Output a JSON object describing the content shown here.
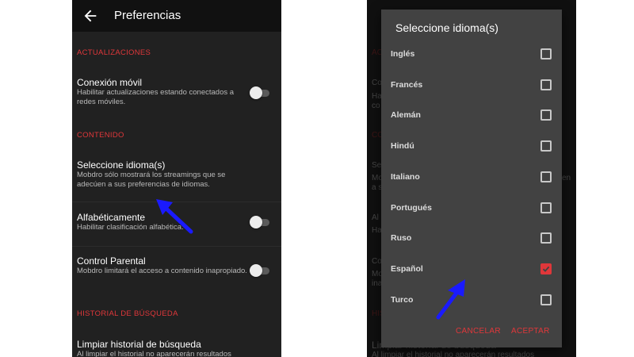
{
  "left_screen": {
    "toolbar_title": "Preferencias",
    "sections": {
      "updates": "ACTUALIZACIONES",
      "content": "CONTENIDO",
      "search_history": "HISTORIAL DE BÚSQUEDA"
    },
    "prefs": {
      "mobile": {
        "title": "Conexión móvil",
        "summary": "Habilitar actualizaciones estando conectados a redes móviles.",
        "enabled": false
      },
      "languages": {
        "title": "Seleccione idioma(s)",
        "summary": "Mobdro sólo mostrará los streamings que se adecúen a sus preferencias de idiomas."
      },
      "alpha": {
        "title": "Alfabéticamente",
        "summary": "Habilitar clasificación alfabética.",
        "enabled": false
      },
      "parental": {
        "title": "Control Parental",
        "summary": "Mobdro limitará el acceso a contenido inapropiado.",
        "enabled": false
      },
      "clear_history": {
        "title": "Limpiar historial de búsqueda",
        "summary": "Al limpiar el historial no aparecerán resultados"
      }
    }
  },
  "right_screen": {
    "bg_fragments": {
      "a": "ACTU",
      "b": "Co",
      "c": "Ha",
      "d": "co",
      "e": "CO",
      "f": "Se",
      "g": "Mo",
      "h": "a s",
      "i": "en",
      "j": "Al",
      "k": "Ha",
      "l": "Co",
      "m": "Mo",
      "n": "ina",
      "o": "HIS",
      "p": "Limpiar historial de búsqueda",
      "q": "Al limpiar el historial no aparecerán resultados"
    },
    "dialog": {
      "title": "Seleccione idioma(s)",
      "options": [
        {
          "label": "Inglés",
          "checked": false
        },
        {
          "label": "Francés",
          "checked": false
        },
        {
          "label": "Alemán",
          "checked": false
        },
        {
          "label": "Hindú",
          "checked": false
        },
        {
          "label": "Italiano",
          "checked": false
        },
        {
          "label": "Portugués",
          "checked": false
        },
        {
          "label": "Ruso",
          "checked": false
        },
        {
          "label": "Español",
          "checked": true
        },
        {
          "label": "Turco",
          "checked": false
        }
      ],
      "cancel_label": "CANCELAR",
      "accept_label": "ACEPTAR"
    }
  },
  "colors": {
    "accent": "#e0373a",
    "background": "#212121",
    "toolbar": "#111111",
    "dialog": "#424242",
    "annotation_arrow": "#1a1aff"
  },
  "icons": {
    "back": "arrow-left-icon",
    "checkbox_checked": "checkmark-icon",
    "annotation": "pointer-arrow-icon"
  }
}
